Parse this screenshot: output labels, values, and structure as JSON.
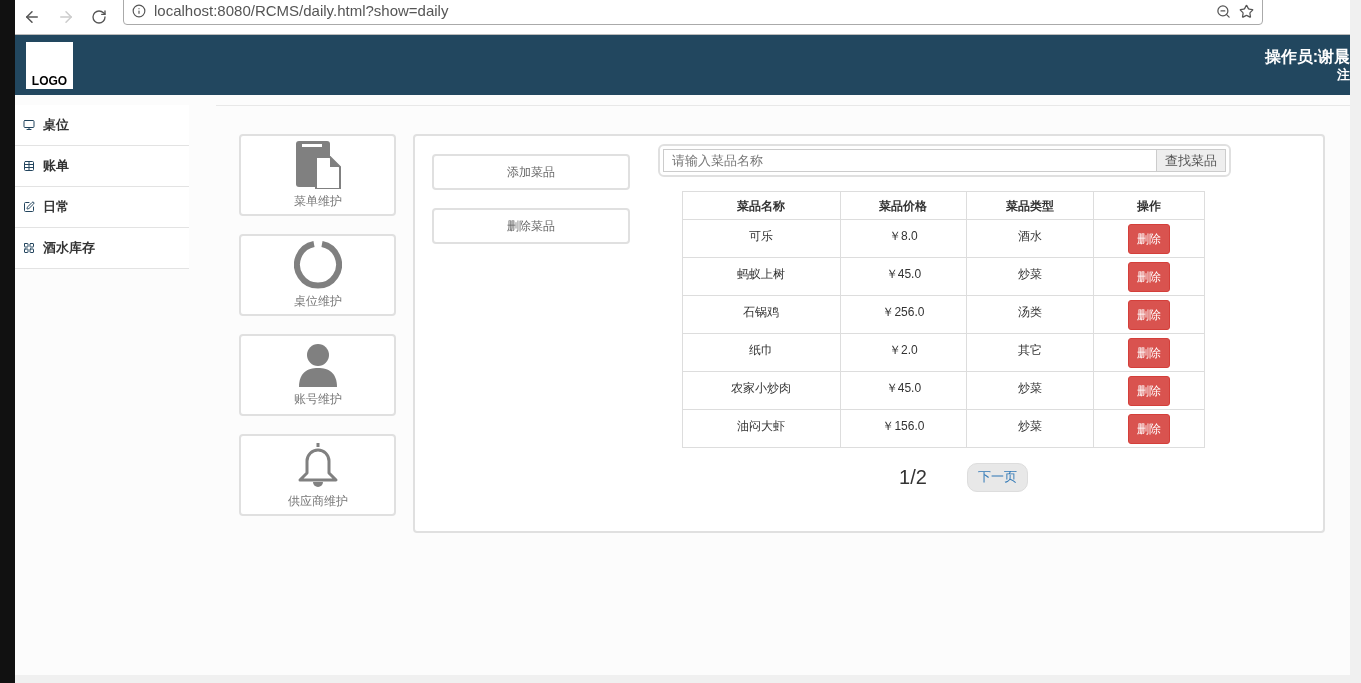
{
  "browser": {
    "url": "localhost:8080/RCMS/daily.html?show=daily"
  },
  "header": {
    "logo": "LOGO",
    "operator": "操作员:谢晨",
    "logout": "注"
  },
  "sidebar": {
    "items": [
      {
        "label": "桌位",
        "kind": "monitor"
      },
      {
        "label": "账单",
        "kind": "table"
      },
      {
        "label": "日常",
        "kind": "edit"
      },
      {
        "label": "酒水库存",
        "kind": "grid"
      }
    ]
  },
  "tiles": [
    {
      "label": "菜单维护",
      "kind": "file"
    },
    {
      "label": "桌位维护",
      "kind": "ring"
    },
    {
      "label": "账号维护",
      "kind": "user"
    },
    {
      "label": "供应商维护",
      "kind": "bell"
    }
  ],
  "actions": [
    "添加菜品",
    "删除菜品"
  ],
  "search": {
    "placeholder": "请输入菜品名称",
    "button": "查找菜品"
  },
  "table": {
    "columns": [
      "菜品名称",
      "菜品价格",
      "菜品类型",
      "操作"
    ],
    "rows": [
      {
        "name": "可乐",
        "price": "￥8.0",
        "type": "酒水",
        "action": "删除"
      },
      {
        "name": "蚂蚁上树",
        "price": "￥45.0",
        "type": "炒菜",
        "action": "删除"
      },
      {
        "name": "石锅鸡",
        "price": "￥256.0",
        "type": "汤类",
        "action": "删除"
      },
      {
        "name": "纸巾",
        "price": "￥2.0",
        "type": "其它",
        "action": "删除"
      },
      {
        "name": "农家小炒肉",
        "price": "￥45.0",
        "type": "炒菜",
        "action": "删除"
      },
      {
        "name": "油闷大虾",
        "price": "￥156.0",
        "type": "炒菜",
        "action": "删除"
      }
    ]
  },
  "pager": {
    "page": "1/2",
    "next": "下一页"
  }
}
